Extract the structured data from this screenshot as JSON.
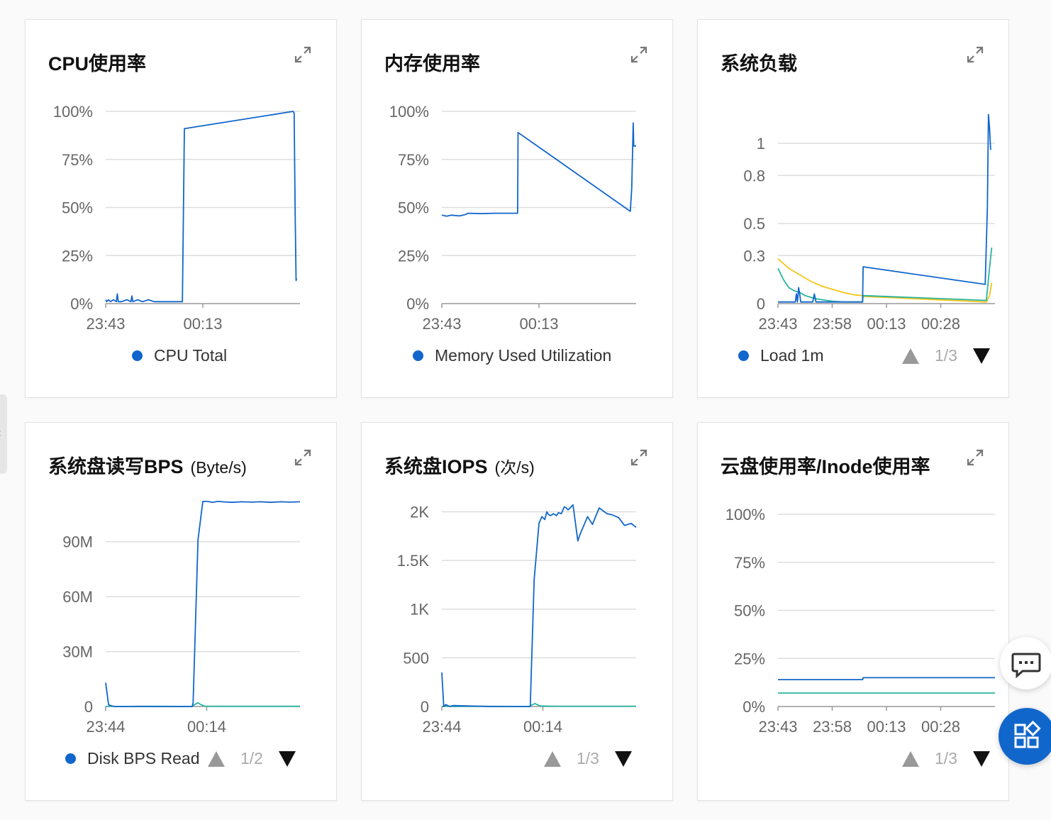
{
  "chart_data": [
    {
      "type": "line",
      "title": "CPU使用率",
      "ylim": [
        0,
        100
      ],
      "yticks": [
        "100%",
        "75%",
        "50%",
        "25%",
        "0%"
      ],
      "ytick_values": [
        100,
        75,
        50,
        25,
        0
      ],
      "xlim": [
        0,
        20
      ],
      "xticks": [
        "23:43",
        "00:13"
      ],
      "xtick_values": [
        0,
        10
      ],
      "legend": [
        "CPU Total"
      ],
      "series": [
        {
          "name": "CPU Total",
          "color": "#1166cc",
          "x": [
            0,
            0.1,
            0.3,
            0.5,
            0.8,
            1.1,
            1.2,
            1.3,
            1.6,
            2.2,
            2.6,
            2.7,
            2.8,
            3.3,
            3.8,
            4.4,
            5.0,
            5.6,
            6.2,
            7.7,
            7.9,
            8.1,
            19.3,
            19.4,
            19.5,
            19.6,
            19.65
          ],
          "y": [
            2,
            1,
            2,
            1,
            2,
            1,
            5,
            1,
            1,
            2,
            1,
            4,
            1,
            2,
            1,
            2,
            1,
            1,
            1,
            1,
            1,
            91,
            100,
            99,
            50,
            12,
            13
          ]
        }
      ]
    },
    {
      "type": "line",
      "title": "内存使用率",
      "ylim": [
        0,
        100
      ],
      "yticks": [
        "100%",
        "75%",
        "50%",
        "25%",
        "0%"
      ],
      "ytick_values": [
        100,
        75,
        50,
        25,
        0
      ],
      "xlim": [
        0,
        20
      ],
      "xticks": [
        "23:43",
        "00:13"
      ],
      "xtick_values": [
        0,
        10
      ],
      "legend": [
        "Memory Used Utilization"
      ],
      "series": [
        {
          "name": "Memory Used Utilization",
          "color": "#1166cc",
          "x": [
            0,
            0.5,
            1.0,
            1.8,
            2.2,
            2.5,
            2.7,
            4.0,
            5.5,
            7.8,
            7.85,
            19.4,
            19.55,
            19.7,
            19.75,
            19.9,
            20
          ],
          "y": [
            46,
            45.5,
            46,
            45.6,
            46,
            46.5,
            47,
            46.8,
            47,
            47,
            89,
            48,
            60,
            94,
            82,
            82,
            82
          ]
        }
      ]
    },
    {
      "type": "line",
      "title": "系统负载",
      "ylim": [
        0,
        1.2
      ],
      "yticks": [
        "1",
        "0.8",
        "0.5",
        "0.3",
        "0"
      ],
      "ytick_values": [
        1,
        0.8,
        0.5,
        0.3,
        0
      ],
      "xlim": [
        0,
        20
      ],
      "xticks": [
        "23:43",
        "23:58",
        "00:13",
        "00:28"
      ],
      "xtick_values": [
        0,
        5,
        10,
        15
      ],
      "legend": [
        "Load 1m"
      ],
      "legend_page": "1/3",
      "series": [
        {
          "name": "Load 1m",
          "color": "#1166cc",
          "x": [
            0,
            1.6,
            1.7,
            1.8,
            1.9,
            2.0,
            2.1,
            2.2,
            3.2,
            3.35,
            3.5,
            4.5,
            5.5,
            7.8,
            7.85,
            19.1,
            19.3,
            19.4,
            19.5,
            19.6
          ],
          "y": [
            0.01,
            0.01,
            0.06,
            0.01,
            0.1,
            0.06,
            0.01,
            0.01,
            0.01,
            0.06,
            0.01,
            0.01,
            0.01,
            0.01,
            0.23,
            0.12,
            0.6,
            1.18,
            1.1,
            0.96
          ]
        },
        {
          "color": "#2ab5a0",
          "x": [
            0,
            0.5,
            1.0,
            1.5,
            2.0,
            2.5,
            3.0,
            3.5,
            4.0,
            4.5,
            5.0,
            6.0,
            7.0,
            7.8,
            7.85,
            19.2,
            19.5,
            19.7
          ],
          "y": [
            0.22,
            0.15,
            0.1,
            0.08,
            0.07,
            0.05,
            0.04,
            0.03,
            0.025,
            0.02,
            0.015,
            0.01,
            0.01,
            0.01,
            0.05,
            0.02,
            0.22,
            0.35
          ]
        },
        {
          "color": "#f5c518",
          "x": [
            0,
            1,
            2,
            3,
            4,
            5,
            6,
            7,
            7.8,
            7.85,
            19.2,
            19.5,
            19.7
          ],
          "y": [
            0.28,
            0.22,
            0.18,
            0.14,
            0.11,
            0.09,
            0.07,
            0.055,
            0.05,
            0.045,
            0.01,
            0.05,
            0.13
          ]
        }
      ]
    },
    {
      "type": "line",
      "title": "系统盘读写BPS",
      "unit": "(Byte/s)",
      "ylim": [
        0,
        117
      ],
      "yticks": [
        "90M",
        "60M",
        "30M",
        "0"
      ],
      "ytick_values": [
        90,
        60,
        30,
        0
      ],
      "xlim": [
        0,
        20
      ],
      "xticks": [
        "23:44",
        "00:14"
      ],
      "xtick_values": [
        0,
        10.4
      ],
      "legend": [
        "Disk BPS Read"
      ],
      "legend_page": "1/2",
      "series": [
        {
          "name": "Disk BPS Read",
          "color": "#1166cc",
          "x": [
            0,
            0.3,
            0.6,
            1.0,
            8.9,
            9.0,
            9.5,
            10.0,
            10.5,
            11,
            11.5,
            12,
            13,
            14,
            15,
            16,
            17,
            18,
            19,
            20
          ],
          "y": [
            13,
            1,
            0.3,
            0,
            0,
            2,
            91,
            112,
            112,
            111.5,
            112,
            111.8,
            111.5,
            111.8,
            111.6,
            111.8,
            111.5,
            111.8,
            111.6,
            111.8
          ]
        },
        {
          "color": "#2ab5a0",
          "x": [
            0,
            0.5,
            1,
            4,
            8.9,
            9.2,
            9.5,
            9.8,
            10.2,
            12,
            16,
            20
          ],
          "y": [
            0,
            0.2,
            0,
            0.1,
            0,
            1.2,
            2,
            1,
            0.2,
            0.1,
            0.1,
            0.1
          ]
        }
      ]
    },
    {
      "type": "line",
      "title": "系统盘IOPS",
      "unit": "(次/s)",
      "ylim": [
        0,
        2200
      ],
      "yticks": [
        "2K",
        "1.5K",
        "1K",
        "500",
        "0"
      ],
      "ytick_values": [
        2000,
        1500,
        1000,
        500,
        0
      ],
      "xlim": [
        0,
        20
      ],
      "xticks": [
        "23:44",
        "00:14"
      ],
      "xtick_values": [
        0,
        10.4
      ],
      "legend_page": "1/3",
      "series": [
        {
          "color": "#1166cc",
          "x": [
            0,
            0.2,
            0.4,
            0.8,
            1.2,
            5,
            9.0,
            9.1,
            9.5,
            10.0,
            10.3,
            10.6,
            10.8,
            11.0,
            11.2,
            11.5,
            11.8,
            12.0,
            12.3,
            12.6,
            12.8,
            13.0,
            13.5,
            14.0,
            14.2,
            15,
            15.5,
            16.2,
            17.0,
            17.5,
            18.2,
            18.8,
            19.5,
            20
          ],
          "y": [
            350,
            0,
            20,
            0,
            10,
            0,
            0,
            0,
            1300,
            1880,
            1950,
            1920,
            2000,
            1970,
            1960,
            1980,
            1960,
            1990,
            1980,
            2050,
            2040,
            2020,
            2070,
            1700,
            1760,
            1950,
            1870,
            2040,
            1980,
            1970,
            1940,
            1860,
            1880,
            1840
          ]
        },
        {
          "color": "#2ab5a0",
          "x": [
            0,
            0.5,
            1.2,
            4,
            9.0,
            9.3,
            9.6,
            9.9,
            10.2,
            12,
            16,
            20
          ],
          "y": [
            0,
            5,
            0,
            2,
            0,
            18,
            30,
            15,
            5,
            3,
            3,
            3
          ]
        }
      ]
    },
    {
      "type": "line",
      "title": "云盘使用率/Inode使用率",
      "ylim": [
        0,
        100
      ],
      "yticks": [
        "100%",
        "75%",
        "50%",
        "25%",
        "0%"
      ],
      "ytick_values": [
        100,
        75,
        50,
        25,
        0
      ],
      "xlim": [
        0,
        20
      ],
      "xticks": [
        "23:43",
        "23:58",
        "00:13",
        "00:28"
      ],
      "xtick_values": [
        0,
        5,
        10,
        15
      ],
      "legend_page": "1/3",
      "series": [
        {
          "color": "#1166cc",
          "x": [
            0,
            7.8,
            7.85,
            20
          ],
          "y": [
            14,
            14,
            15,
            15
          ]
        },
        {
          "color": "#2ab5a0",
          "x": [
            0,
            20
          ],
          "y": [
            7,
            7
          ]
        }
      ]
    }
  ]
}
